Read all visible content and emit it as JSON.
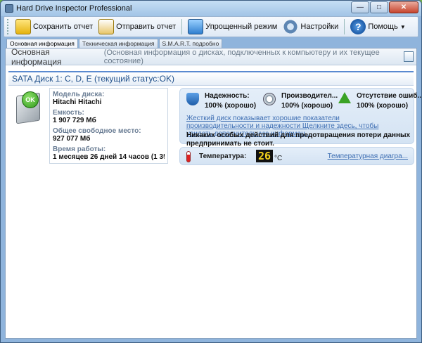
{
  "window": {
    "title": "Hard Drive Inspector Professional"
  },
  "toolbar": {
    "save_report": "Сохранить отчет",
    "send_report": "Отправить отчет",
    "simple_mode": "Упрощенный режим",
    "settings": "Настройки",
    "help": "Помощь"
  },
  "tabs": [
    "Основная информация",
    "Техническая информация",
    "S.M.A.R.T. подробно"
  ],
  "section": {
    "title": "Основная информация",
    "subtitle": "(Основная информация о дисках, подключенных к компьютеру и  их текущее состояние)"
  },
  "disk": {
    "title": "SATA Диск 1: C, D, E (текущий статус:OK)",
    "badge": "OK",
    "model_label": "Модель диска:",
    "model_value": "Hitachi Hitachi",
    "capacity_label": "Емкость:",
    "capacity_value": "1 907 729 Мб",
    "free_label": "Общее свободное место:",
    "free_value": "927 077 Мб",
    "uptime_label": "Время работы:",
    "uptime_value": "1 месяцев 26 дней 14 часов (1 358..."
  },
  "status": {
    "reliability_label": "Надежность:",
    "reliability_value": "100% (хорошо)",
    "performance_label": "Производител...",
    "performance_value": "100% (хорошо)",
    "errors_label": "Отсутствие ошиб...",
    "errors_value": "100% (хорошо)",
    "link_text": "Жесткий диск показывает хорошие показатели производительности и надежности Щелкните здесь, чтобы увидеть дополнительную информац...",
    "advice": "Никаких особых действий для предотвращения потери данных предпринимать не стоит."
  },
  "temperature": {
    "label": "Температура:",
    "value": "26",
    "unit": "°C",
    "diagram_link": "Температурная диагра..."
  },
  "colors": {
    "accent": "#1f4f8a",
    "link": "#3f6fb3",
    "ok": "#2f9a1a"
  }
}
